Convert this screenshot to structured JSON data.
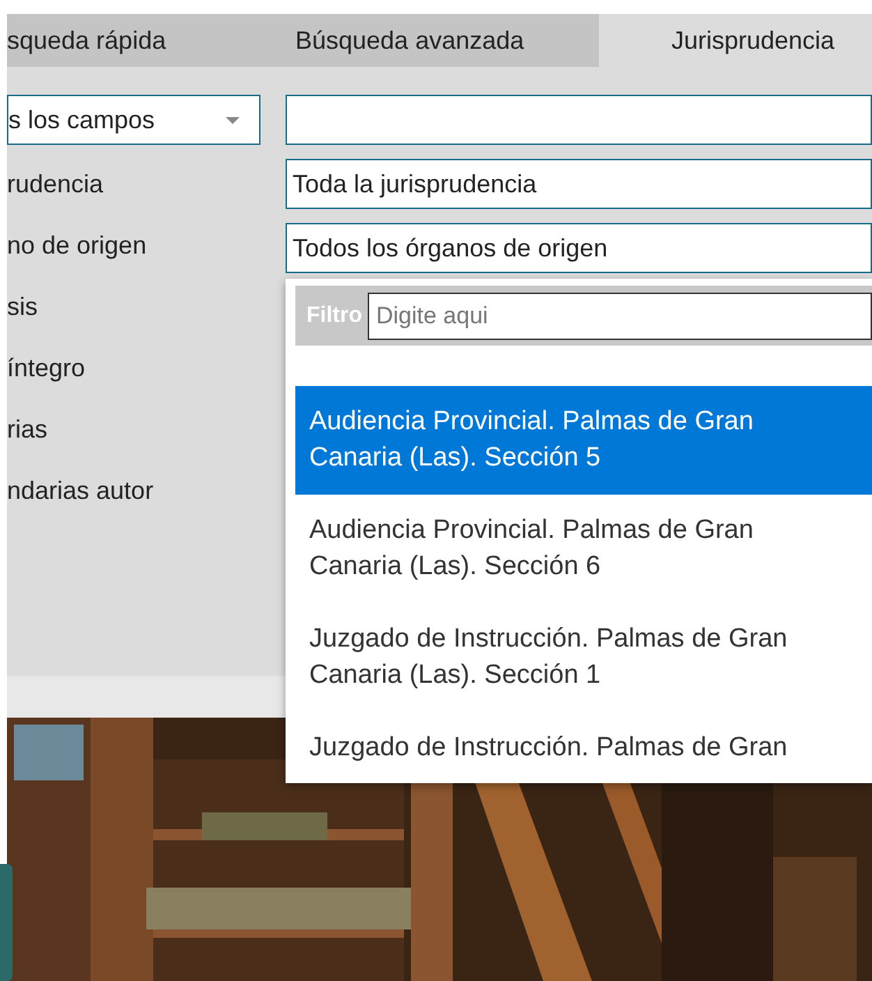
{
  "tabs": [
    {
      "label": "squeda rápida",
      "selected": false
    },
    {
      "label": "Búsqueda avanzada",
      "selected": false
    },
    {
      "label": "Jurisprudencia",
      "selected": true
    }
  ],
  "field_select": {
    "value": "s los campos"
  },
  "labels": [
    "rudencia",
    "no de origen",
    "sis",
    "íntegro",
    "rias",
    "ndarias autor"
  ],
  "jurisprudencia_field": {
    "value": "Toda la jurisprudencia"
  },
  "organo_field": {
    "value": "Todos los órganos de origen"
  },
  "dropdown": {
    "filter_label": "Filtro",
    "filter_placeholder": "Digite aqui",
    "options": [
      {
        "label": "Audiencia Provincial. Palmas de Gran Canaria (Las). Sección 5",
        "selected": true
      },
      {
        "label": "Audiencia Provincial. Palmas de Gran Canaria (Las). Sección 6",
        "selected": false
      },
      {
        "label": "Juzgado de Instrucción. Palmas de Gran Canaria (Las). Sección 1",
        "selected": false
      },
      {
        "label": "Juzgado de Instrucción. Palmas de Gran",
        "selected": false
      }
    ]
  }
}
